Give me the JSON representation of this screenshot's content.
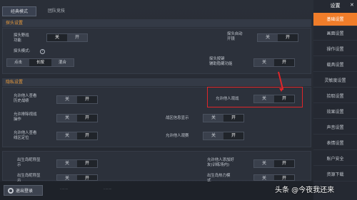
{
  "tabs": {
    "active": "经典模式",
    "inactive": "团队竞技"
  },
  "sections": {
    "scope": "探头设置",
    "privacy": "隐私设置"
  },
  "scope": {
    "peek_color_label": "探头野战\n功能",
    "peek_color_off": "关",
    "peek_color_on": "开",
    "auto_peek_label": "探头自动\n开镜",
    "auto_peek_off": "关",
    "auto_peek_on": "开",
    "peek_mode_label": "探头模式:",
    "peek_mode_options": [
      "点击",
      "长按",
      "混合"
    ],
    "peek_mode_selected": "长按",
    "peek_assist_label": "探头按键\n辅助隐藏功能",
    "peek_assist_off": "关",
    "peek_assist_on": "开"
  },
  "privacy": {
    "history_label": "允许他人查看\n历史战绩",
    "history_off": "关",
    "history_on": "开",
    "allow_view_label": "允许他人观战",
    "allow_view_off": "关",
    "allow_view_on": "开",
    "rank_label": "允许排除视战\n操作",
    "rank_off": "关",
    "rank_on": "开",
    "combat_info_label": "战区信息显示",
    "combat_info_off": "关",
    "combat_info_on": "开",
    "location_label": "允许他人查看\n线区定位",
    "location_off": "关",
    "location_on": "开",
    "watch_mine_label": "允许他人观赛",
    "watch_mine_off": "关",
    "watch_mine_on": "开",
    "show_nick_label": "出生岛昵称显\n示",
    "show_nick_off": "关",
    "show_nick_on": "开",
    "add_friend_label": "允许他人添加好\n友(训练场内)",
    "add_friend_off": "关",
    "add_friend_on": "开",
    "show_nick2_label": "出生岛昵称显\n示",
    "show_nick2_off": "关",
    "show_nick2_on": "开",
    "birth_island_label": "出生岛热力模\n式",
    "birth_island_off": "关",
    "birth_island_on": "开"
  },
  "bottom": {
    "logout": "退出登录",
    "note1": "·········",
    "note2": "·········"
  },
  "sidebar": {
    "title": "设置",
    "close": "✕",
    "items": [
      {
        "label": "基础设置",
        "active": true
      },
      {
        "label": "画面设置",
        "active": false
      },
      {
        "label": "操作设置",
        "active": false
      },
      {
        "label": "载具设置",
        "active": false
      },
      {
        "label": "灵敏度设置",
        "active": false
      },
      {
        "label": "拾取设置",
        "active": false
      },
      {
        "label": "效果设置",
        "active": false
      },
      {
        "label": "声音设置",
        "active": false
      },
      {
        "label": "表情设置",
        "active": false
      },
      {
        "label": "账户安全",
        "active": false
      },
      {
        "label": "资源下载",
        "active": false
      }
    ]
  },
  "watermark": "头条 @今夜我还来",
  "colors": {
    "accent": "#f07d2a",
    "highlight": "#e0262a",
    "section_text": "#e79a3c"
  }
}
